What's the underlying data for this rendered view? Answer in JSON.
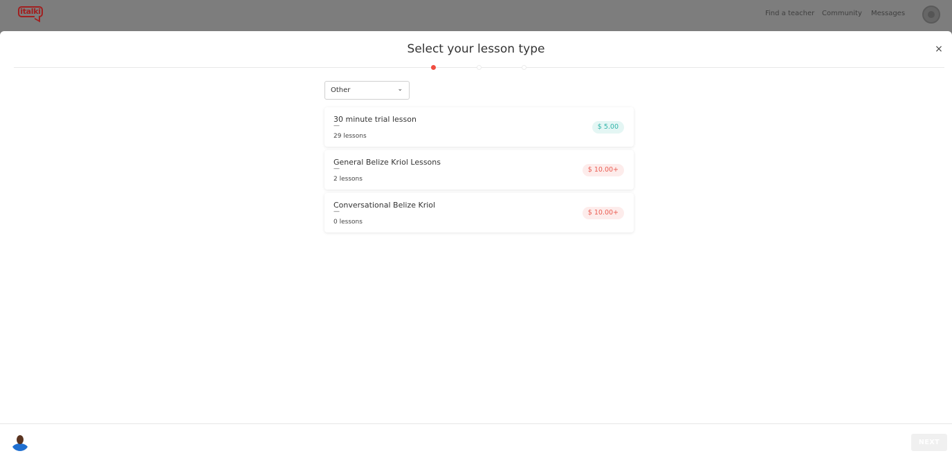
{
  "nav": {
    "logo": "italki",
    "links": [
      "Find a teacher",
      "Community",
      "Messages"
    ]
  },
  "modal": {
    "title": "Select your lesson type",
    "filter": {
      "selected": "Other"
    },
    "lessons": [
      {
        "name": "30 minute trial lesson",
        "dash": "—",
        "count": "29 lessons",
        "price": "$ 5.00"
      },
      {
        "name": "General Belize Kriol Lessons",
        "dash": "—",
        "count": "2 lessons",
        "price": "$ 10.00+"
      },
      {
        "name": "Conversational Belize Kriol",
        "dash": "—",
        "count": "0 lessons",
        "price": "$ 10.00+"
      }
    ],
    "next_label": "NEXT",
    "close_icon": "×",
    "chevron_icon": "⌄"
  },
  "steps": {
    "current": 1,
    "total": 3
  },
  "colors": {
    "accent": "#f04d41",
    "trial_price": "#2fb3a8",
    "regular_price": "#ea5b50",
    "brand": "#a11f1f"
  }
}
